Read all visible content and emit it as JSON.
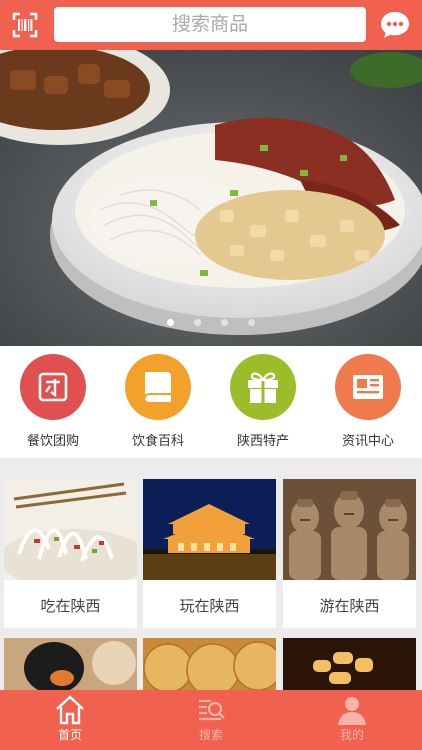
{
  "header": {
    "search_placeholder": "搜索商品"
  },
  "banner": {
    "slides": 4,
    "active_slide": 1
  },
  "categories": [
    {
      "label": "餐饮团购",
      "icon": "coupon-icon",
      "color": "#e0504f"
    },
    {
      "label": "饮食百科",
      "icon": "book-icon",
      "color": "#f2a22a"
    },
    {
      "label": "陕西特产",
      "icon": "gift-icon",
      "color": "#9cbc2a"
    },
    {
      "label": "资讯中心",
      "icon": "news-icon",
      "color": "#f07a4c"
    }
  ],
  "cards": [
    {
      "label": "吃在陕西"
    },
    {
      "label": "玩在陕西"
    },
    {
      "label": "游在陕西"
    }
  ],
  "tabbar": [
    {
      "label": "首页",
      "icon": "home-icon",
      "active": true
    },
    {
      "label": "搜索",
      "icon": "search-icon",
      "active": false
    },
    {
      "label": "我的",
      "icon": "user-icon",
      "active": false
    }
  ],
  "colors": {
    "brand": "#f0614f"
  }
}
